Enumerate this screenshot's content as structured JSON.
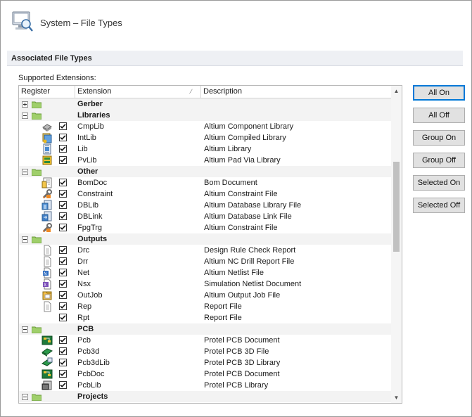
{
  "header": {
    "title": "System – File Types",
    "icon": "system-monitor-icon"
  },
  "section": {
    "title": "Associated File Types"
  },
  "list": {
    "label": "Supported Extensions:",
    "columns": [
      "Register",
      "Extension",
      "Description"
    ],
    "rows": [
      {
        "type": "group",
        "name": "Gerber",
        "expanded": false
      },
      {
        "type": "group",
        "name": "Libraries",
        "expanded": true
      },
      {
        "type": "item",
        "icon": "component-lib-icon",
        "ext": "CmpLib",
        "desc": "Altium Component Library"
      },
      {
        "type": "item",
        "icon": "compiled-lib-icon",
        "ext": "IntLib",
        "desc": "Altium Compiled Library"
      },
      {
        "type": "item",
        "icon": "library-icon",
        "ext": "Lib",
        "desc": "Altium Library"
      },
      {
        "type": "item",
        "icon": "pad-via-lib-icon",
        "ext": "PvLib",
        "desc": "Altium Pad Via Library"
      },
      {
        "type": "group",
        "name": "Other",
        "expanded": true
      },
      {
        "type": "item",
        "icon": "bom-doc-icon",
        "ext": "BomDoc",
        "desc": "Bom Document"
      },
      {
        "type": "item",
        "icon": "constraint-icon",
        "ext": "Constraint",
        "desc": "Altium Constraint File"
      },
      {
        "type": "item",
        "icon": "database-lib-icon",
        "ext": "DBLib",
        "desc": "Altium Database Library File"
      },
      {
        "type": "item",
        "icon": "database-link-icon",
        "ext": "DBLink",
        "desc": "Altium Database Link File"
      },
      {
        "type": "item",
        "icon": "constraint-icon",
        "ext": "FpgTrg",
        "desc": "Altium Constraint File"
      },
      {
        "type": "group",
        "name": "Outputs",
        "expanded": true
      },
      {
        "type": "item",
        "icon": "document-icon",
        "ext": "Drc",
        "desc": "Design Rule Check Report"
      },
      {
        "type": "item",
        "icon": "document-icon",
        "ext": "Drr",
        "desc": "Altium NC Drill Report File"
      },
      {
        "type": "item",
        "icon": "netlist-icon",
        "ext": "Net",
        "desc": "Altium Netlist File"
      },
      {
        "type": "item",
        "icon": "sim-netlist-icon",
        "ext": "Nsx",
        "desc": "Simulation Netlist Document"
      },
      {
        "type": "item",
        "icon": "output-job-icon",
        "ext": "OutJob",
        "desc": "Altium Output Job File"
      },
      {
        "type": "item",
        "icon": "document-icon",
        "ext": "Rep",
        "desc": "Report File"
      },
      {
        "type": "item",
        "icon": "none",
        "ext": "Rpt",
        "desc": "Report File"
      },
      {
        "type": "group",
        "name": "PCB",
        "expanded": true
      },
      {
        "type": "item",
        "icon": "pcb-doc-icon",
        "ext": "Pcb",
        "desc": "Protel PCB Document"
      },
      {
        "type": "item",
        "icon": "pcb-3d-icon",
        "ext": "Pcb3d",
        "desc": "Protel PCB 3D File"
      },
      {
        "type": "item",
        "icon": "pcb-3d-lib-icon",
        "ext": "Pcb3dLib",
        "desc": "Protel PCB 3D Library"
      },
      {
        "type": "item",
        "icon": "pcb-doc-icon",
        "ext": "PcbDoc",
        "desc": "Protel PCB Document"
      },
      {
        "type": "item",
        "icon": "pcb-lib-icon",
        "ext": "PcbLib",
        "desc": "Protel PCB Library"
      },
      {
        "type": "group",
        "name": "Projects",
        "expanded": true
      }
    ]
  },
  "buttons": {
    "all_on": "All On",
    "all_off": "All Off",
    "group_on": "Group On",
    "group_off": "Group Off",
    "selected_on": "Selected On",
    "selected_off": "Selected Off"
  }
}
